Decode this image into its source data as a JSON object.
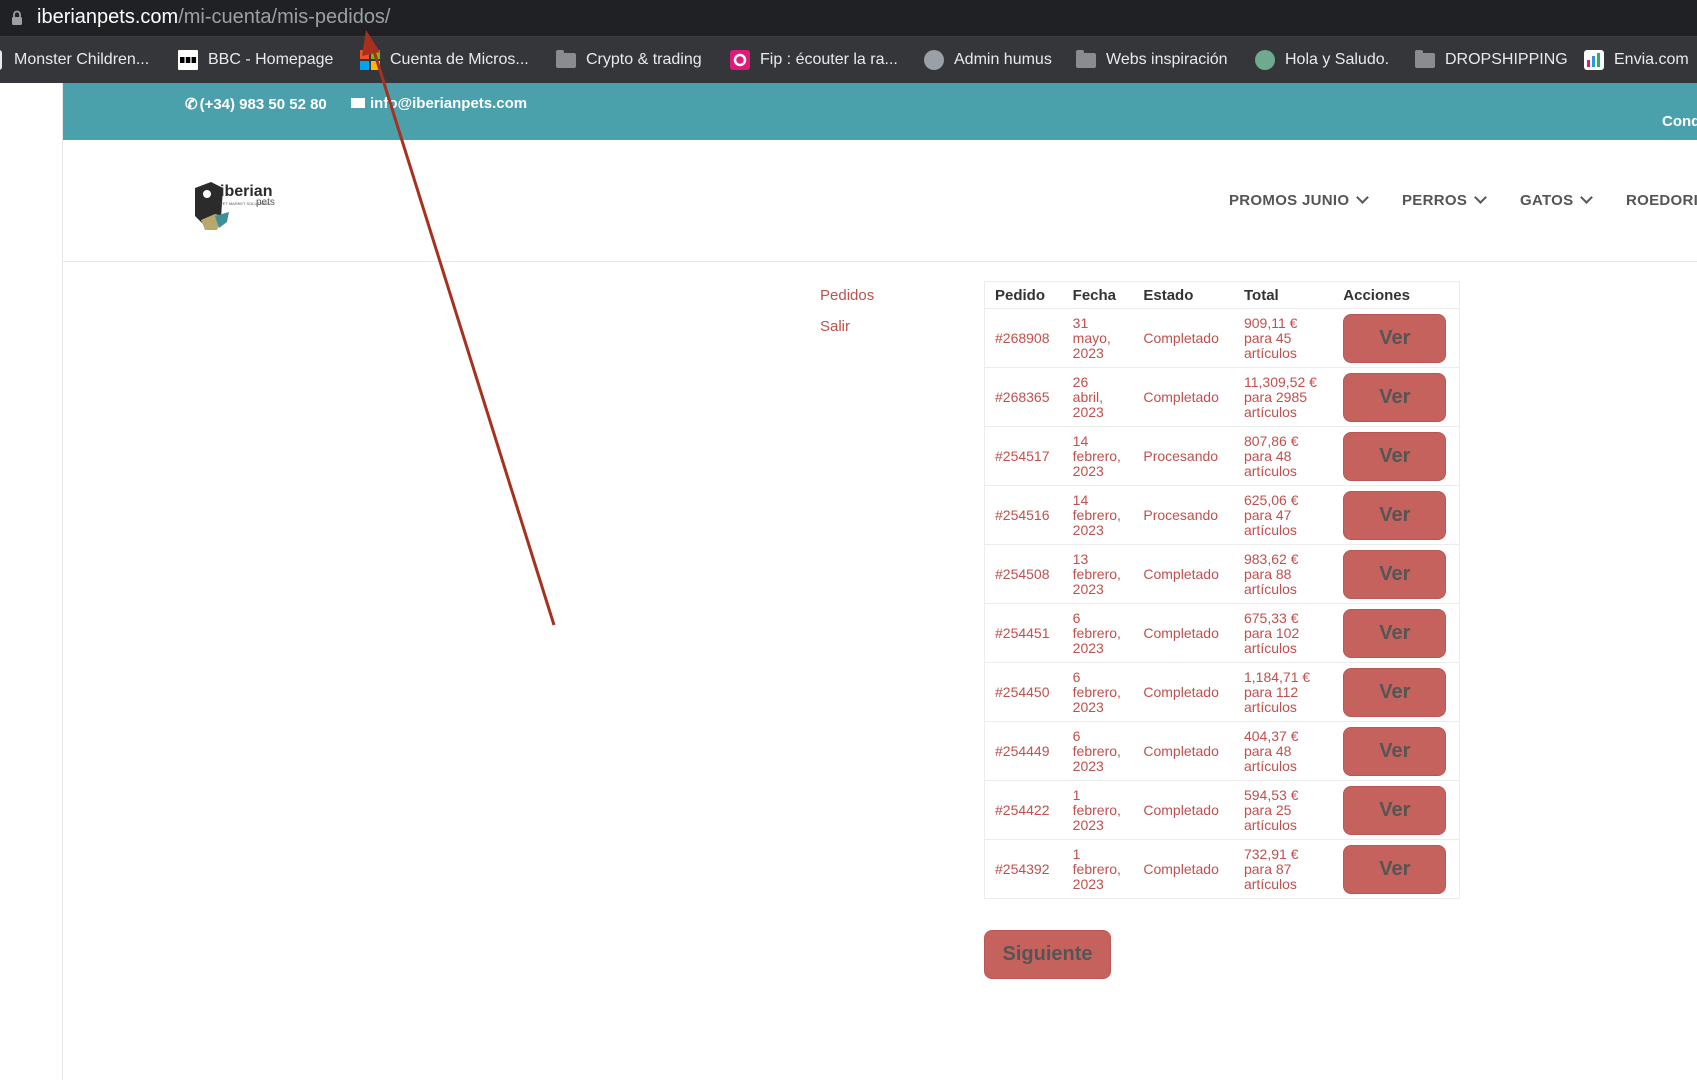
{
  "browser": {
    "url_host": "iberianpets.com",
    "url_path": "/mi-cuenta/mis-pedidos/",
    "bookmarks": [
      {
        "label": "Monster Children...",
        "icon": "monster-children-icon"
      },
      {
        "label": "BBC - Homepage",
        "icon": "bbc-icon"
      },
      {
        "label": "Cuenta de Micros...",
        "icon": "microsoft-icon"
      },
      {
        "label": "Crypto & trading",
        "icon": "folder-icon"
      },
      {
        "label": "Fip : écouter la ra...",
        "icon": "fip-icon"
      },
      {
        "label": "Admin humus",
        "icon": "globe-icon"
      },
      {
        "label": "Webs inspiración",
        "icon": "folder-icon"
      },
      {
        "label": "Hola y Saludo.",
        "icon": "openai-icon"
      },
      {
        "label": "DROPSHIPPING",
        "icon": "folder-icon"
      },
      {
        "label": "Envia.com",
        "icon": "envia-icon"
      }
    ]
  },
  "topbar": {
    "phone": "(+34) 983 50 52 80",
    "email": "info@iberianpets.com",
    "right_text": "Cond",
    "bg_color": "#4ba1ab"
  },
  "header": {
    "logo_text": "iberian",
    "logo_sub": "pets",
    "logo_tag": "PET MARKET SOLUTIONS",
    "nav": [
      "PROMOS JUNIO",
      "PERROS",
      "GATOS",
      "ROEDORI"
    ]
  },
  "account_nav": [
    "Pedidos",
    "Salir"
  ],
  "orders": {
    "headers": [
      "Pedido",
      "Fecha",
      "Estado",
      "Total",
      "Acciones"
    ],
    "view_label": "Ver",
    "rows": [
      {
        "id": "#268908",
        "date": [
          "31",
          "mayo,",
          "2023"
        ],
        "status": "Completado",
        "total": [
          "909,11 €",
          "para 45",
          "artículos"
        ]
      },
      {
        "id": "#268365",
        "date": [
          "26",
          "abril,",
          "2023"
        ],
        "status": "Completado",
        "total": [
          "11,309,52 €",
          "para 2985",
          "artículos"
        ]
      },
      {
        "id": "#254517",
        "date": [
          "14",
          "febrero,",
          "2023"
        ],
        "status": "Procesando",
        "total": [
          "807,86 €",
          "para 48",
          "artículos"
        ]
      },
      {
        "id": "#254516",
        "date": [
          "14",
          "febrero,",
          "2023"
        ],
        "status": "Procesando",
        "total": [
          "625,06 €",
          "para 47",
          "artículos"
        ]
      },
      {
        "id": "#254508",
        "date": [
          "13",
          "febrero,",
          "2023"
        ],
        "status": "Completado",
        "total": [
          "983,62 €",
          "para 88",
          "artículos"
        ]
      },
      {
        "id": "#254451",
        "date": [
          "6",
          "febrero,",
          "2023"
        ],
        "status": "Completado",
        "total": [
          "675,33 €",
          "para 102",
          "artículos"
        ]
      },
      {
        "id": "#254450",
        "date": [
          "6",
          "febrero,",
          "2023"
        ],
        "status": "Completado",
        "total": [
          "1,184,71 €",
          "para 112",
          "artículos"
        ]
      },
      {
        "id": "#254449",
        "date": [
          "6",
          "febrero,",
          "2023"
        ],
        "status": "Completado",
        "total": [
          "404,37 €",
          "para 48",
          "artículos"
        ]
      },
      {
        "id": "#254422",
        "date": [
          "1",
          "febrero,",
          "2023"
        ],
        "status": "Completado",
        "total": [
          "594,53 €",
          "para 25",
          "artículos"
        ]
      },
      {
        "id": "#254392",
        "date": [
          "1",
          "febrero,",
          "2023"
        ],
        "status": "Completado",
        "total": [
          "732,91 €",
          "para 87",
          "artículos"
        ]
      }
    ]
  },
  "pagination": {
    "next_label": "Siguiente"
  },
  "colors": {
    "accent": "#c0504d",
    "button": "#c6625e",
    "annotation_arrow": "#a8301f"
  }
}
